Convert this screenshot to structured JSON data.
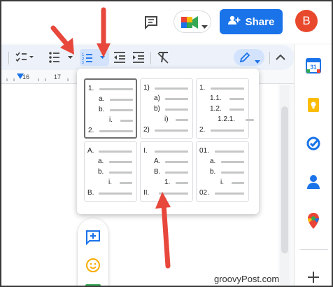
{
  "header": {
    "share_label": "Share",
    "avatar_letter": "B",
    "icons": [
      "comment-history-icon",
      "meet-icon",
      "chevron-down-icon"
    ]
  },
  "toolbar": {
    "items": [
      "checklist-icon",
      "bulleted-list-icon",
      "numbered-list-icon",
      "decrease-indent-icon",
      "increase-indent-icon",
      "clear-formatting-icon",
      "edit-mode-pencil-icon",
      "collapse-chevron-icon"
    ],
    "accent": "#1a73e8"
  },
  "ruler": {
    "marks": [
      "16",
      "17"
    ]
  },
  "numbered_list_menu": {
    "options": [
      {
        "labels": [
          "1.",
          "a.",
          "b.",
          "i.",
          "2."
        ],
        "selected": true
      },
      {
        "labels": [
          "1)",
          "a)",
          "b)",
          "i)",
          "2)"
        ],
        "selected": false
      },
      {
        "labels": [
          "1.",
          "1.1.",
          "1.2.",
          "1.2.1.",
          "2."
        ],
        "selected": false
      },
      {
        "labels": [
          "A.",
          "a.",
          "b.",
          "i.",
          "B."
        ],
        "selected": false
      },
      {
        "labels": [
          "I.",
          "A.",
          "B.",
          "1.",
          "II."
        ],
        "selected": false
      },
      {
        "labels": [
          "01.",
          "a.",
          "b.",
          "i.",
          "02."
        ],
        "selected": false
      }
    ]
  },
  "side_panel": {
    "items": [
      "calendar-icon",
      "keep-icon",
      "tasks-icon",
      "contacts-icon",
      "maps-icon",
      "add-icon"
    ],
    "calendar_day": "31"
  },
  "floating_rail": {
    "items": [
      "add-comment-icon",
      "emoji-icon"
    ]
  },
  "annotation_arrows": {
    "color": "#e8473c"
  },
  "watermark": "groovyPost.com"
}
